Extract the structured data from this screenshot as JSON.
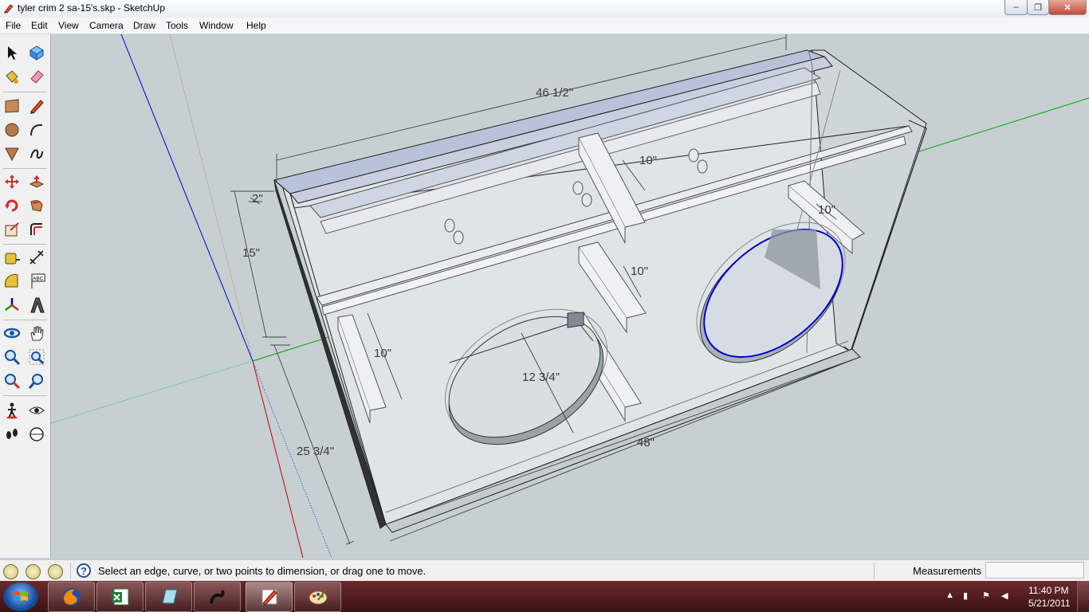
{
  "window": {
    "title": "tyler crim 2 sa-15's.skp - SketchUp",
    "min_label": "‒",
    "max_label": "❐",
    "close_label": "✕"
  },
  "menu": [
    "File",
    "Edit",
    "View",
    "Camera",
    "Draw",
    "Tools",
    "Window",
    "Help"
  ],
  "toolbar": {
    "tools": [
      "select-icon",
      "make-component-icon",
      "paint-bucket-icon",
      "eraser-icon",
      "rectangle-icon",
      "pencil-icon",
      "circle-icon",
      "arc-icon",
      "polygon-icon",
      "freehand-icon",
      "move-icon",
      "push-pull-icon",
      "rotate-icon",
      "follow-me-icon",
      "scale-icon",
      "offset-icon",
      "tape-measure-icon",
      "dimension-icon",
      "protractor-icon",
      "text-icon",
      "axes-icon",
      "3d-text-icon",
      "orbit-icon",
      "pan-icon",
      "zoom-icon",
      "zoom-window-icon",
      "zoom-extents-icon",
      "previous-view-icon",
      "walk-icon",
      "look-around-icon",
      "position-camera-icon",
      "section-plane-icon"
    ],
    "text_icon_label": "ABC"
  },
  "model": {
    "dimensions": {
      "width_top": "46 1/2\"",
      "brace_top": "10\"",
      "thickness": "2\"",
      "height_15": "15\"",
      "brace_right": "10\"",
      "brace_mid": "10\"",
      "brace_left": "10\"",
      "sub_diameter": "12 3/4\"",
      "height_total": "25 3/4\"",
      "width_bottom": "48\""
    },
    "colors": {
      "red_axis": "#cc0000",
      "green_axis": "#00aa00",
      "blue_axis": "#0000cc",
      "selected_edge": "#0000cc"
    }
  },
  "status": {
    "message": "Select an edge, curve, or two points to dimension, or drag one to move.",
    "measurements_label": "Measurements",
    "measurements_value": ""
  },
  "taskbar": {
    "apps": [
      "firefox-icon",
      "excel-icon",
      "notepad-icon",
      "logitech-icon",
      "sketchup-icon",
      "paint-icon"
    ],
    "clock_time": "11:40 PM",
    "clock_date": "5/21/2011"
  }
}
